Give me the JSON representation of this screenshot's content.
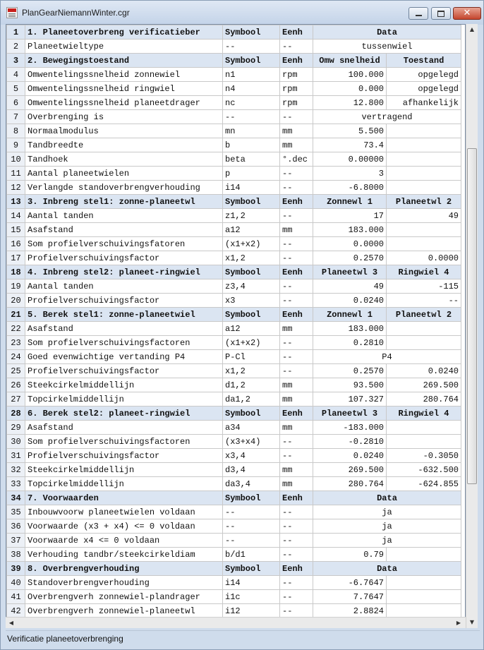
{
  "window": {
    "title": "PlanGearNiemannWinter.cgr"
  },
  "titlebar_buttons": {
    "close_glyph": "✕"
  },
  "status": {
    "text": "Verificatie planeetoverbrenging"
  },
  "scroll": {
    "up": "▲",
    "down": "▼",
    "left": "◀",
    "right": "▶"
  },
  "rows": [
    {
      "n": "1",
      "hdr": true,
      "a": "1. Planeetoverbreng verificatieber",
      "b": "Symbool",
      "c": "Eenh",
      "d": "",
      "e": "",
      "span": "Data"
    },
    {
      "n": "2",
      "a": "Planeetwieltype",
      "b": "--",
      "c": "--",
      "d": "",
      "e": "",
      "span": "tussenwiel"
    },
    {
      "n": "3",
      "hdr": true,
      "a": "2. Bewegingstoestand",
      "b": "Symbool",
      "c": "Eenh",
      "d": "Omw snelheid",
      "e": "Toestand"
    },
    {
      "n": "4",
      "a": "Omwentelingssnelheid zonnewiel",
      "b": "n1",
      "c": "rpm",
      "d": "100.000",
      "e": "opgelegd"
    },
    {
      "n": "5",
      "a": "Omwentelingssnelheid ringwiel",
      "b": "n4",
      "c": "rpm",
      "d": "0.000",
      "e": "opgelegd"
    },
    {
      "n": "6",
      "a": "Omwentelingssnelheid planeetdrager",
      "b": "nc",
      "c": "rpm",
      "d": "12.800",
      "e": "afhankelijk"
    },
    {
      "n": "7",
      "a": "Overbrenging is",
      "b": "--",
      "c": "--",
      "d": "",
      "e": "",
      "span": "vertragend"
    },
    {
      "n": "8",
      "a": "Normaalmodulus",
      "b": "mn",
      "c": "mm",
      "d": "5.500",
      "e": ""
    },
    {
      "n": "9",
      "a": "Tandbreedte",
      "b": "b",
      "c": "mm",
      "d": "73.4",
      "e": ""
    },
    {
      "n": "10",
      "a": "Tandhoek",
      "b": "beta",
      "c": "°.dec",
      "d": "0.00000",
      "e": ""
    },
    {
      "n": "11",
      "a": "Aantal planeetwielen",
      "b": "p",
      "c": "--",
      "d": "3",
      "e": ""
    },
    {
      "n": "12",
      "a": "Verlangde standoverbrengverhouding",
      "b": "i14",
      "c": "--",
      "d": "-6.8000",
      "e": ""
    },
    {
      "n": "13",
      "hdr": true,
      "a": "3. Inbreng stel1: zonne-planeetwl",
      "b": "Symbool",
      "c": "Eenh",
      "d": "Zonnewl 1",
      "e": "Planeetwl 2"
    },
    {
      "n": "14",
      "a": "Aantal tanden",
      "b": "z1,2",
      "c": "--",
      "d": "17",
      "e": "49"
    },
    {
      "n": "15",
      "a": "Asafstand",
      "b": "a12",
      "c": "mm",
      "d": "183.000",
      "e": ""
    },
    {
      "n": "16",
      "a": "Som profielverschuivingsfatoren",
      "b": "(x1+x2)",
      "c": "--",
      "d": "0.0000",
      "e": ""
    },
    {
      "n": "17",
      "a": "Profielverschuivingsfactor",
      "b": "x1,2",
      "c": "--",
      "d": "0.2570",
      "e": "0.0000"
    },
    {
      "n": "18",
      "hdr": true,
      "a": "4. Inbreng stel2: planeet-ringwiel",
      "b": "Symbool",
      "c": "Eenh",
      "d": "Planeetwl 3",
      "e": "Ringwiel 4"
    },
    {
      "n": "19",
      "a": "Aantal tanden",
      "b": "z3,4",
      "c": "--",
      "d": "49",
      "e": "-115"
    },
    {
      "n": "20",
      "a": "Profielverschuivingsfactor",
      "b": "x3",
      "c": "--",
      "d": "0.0240",
      "e": "--"
    },
    {
      "n": "21",
      "hdr": true,
      "a": "5. Berek stel1: zonne-planeetwiel",
      "b": "Symbool",
      "c": "Eenh",
      "d": "Zonnewl 1",
      "e": "Planeetwl 2"
    },
    {
      "n": "22",
      "a": "Asafstand",
      "b": "a12",
      "c": "mm",
      "d": "183.000",
      "e": ""
    },
    {
      "n": "23",
      "a": "Som profielverschuivingsfactoren",
      "b": "(x1+x2)",
      "c": "--",
      "d": "0.2810",
      "e": ""
    },
    {
      "n": "24",
      "a": "Goed evenwichtige vertanding    P4",
      "b": "P-Cl",
      "c": "--",
      "d": "",
      "e": "",
      "span": "P4"
    },
    {
      "n": "25",
      "a": "Profielverschuivingsfactor",
      "b": "x1,2",
      "c": "--",
      "d": "0.2570",
      "e": "0.0240"
    },
    {
      "n": "26",
      "a": "Steekcirkelmiddellijn",
      "b": "d1,2",
      "c": "mm",
      "d": "93.500",
      "e": "269.500"
    },
    {
      "n": "27",
      "a": "Topcirkelmiddellijn",
      "b": "da1,2",
      "c": "mm",
      "d": "107.327",
      "e": "280.764"
    },
    {
      "n": "28",
      "hdr": true,
      "a": "6. Berek stel2: planeet-ringwiel",
      "b": "Symbool",
      "c": "Eenh",
      "d": "Planeetwl 3",
      "e": "Ringwiel 4"
    },
    {
      "n": "29",
      "a": "Asafstand",
      "b": "a34",
      "c": "mm",
      "d": "-183.000",
      "e": ""
    },
    {
      "n": "30",
      "a": "Som profielverschuivingsfactoren",
      "b": "(x3+x4)",
      "c": "--",
      "d": "-0.2810",
      "e": ""
    },
    {
      "n": "31",
      "a": "Profielverschuivingsfactor",
      "b": "x3,4",
      "c": "--",
      "d": "0.0240",
      "e": "-0.3050"
    },
    {
      "n": "32",
      "a": "Steekcirkelmiddellijn",
      "b": "d3,4",
      "c": "mm",
      "d": "269.500",
      "e": "-632.500"
    },
    {
      "n": "33",
      "a": "Topcirkelmiddellijn",
      "b": "da3,4",
      "c": "mm",
      "d": "280.764",
      "e": "-624.855"
    },
    {
      "n": "34",
      "hdr": true,
      "a": "7. Voorwaarden",
      "b": "Symbool",
      "c": "Eenh",
      "d": "",
      "e": "",
      "span": "Data"
    },
    {
      "n": "35",
      "a": "Inbouwvoorw planeetwielen voldaan",
      "b": "--",
      "c": "--",
      "d": "",
      "e": "",
      "span": "ja"
    },
    {
      "n": "36",
      "a": "Voorwaarde (x3 + x4) <= 0 voldaan",
      "b": "--",
      "c": "--",
      "d": "",
      "e": "",
      "span": "ja"
    },
    {
      "n": "37",
      "a": "Voorwaarde x4 <= 0 voldaan",
      "b": "--",
      "c": "--",
      "d": "",
      "e": "",
      "span": "ja"
    },
    {
      "n": "38",
      "a": "Verhouding tandbr/steekcirkeldiam",
      "b": "b/d1",
      "c": "--",
      "d": "0.79",
      "e": ""
    },
    {
      "n": "39",
      "hdr": true,
      "a": "8. Overbrengverhouding",
      "b": "Symbool",
      "c": "Eenh",
      "d": "",
      "e": "",
      "span": "Data"
    },
    {
      "n": "40",
      "a": "Standoverbrengverhouding",
      "b": "i14",
      "c": "--",
      "d": "-6.7647",
      "e": ""
    },
    {
      "n": "41",
      "a": "Overbrengverh zonnewiel-plandrager",
      "b": "i1c",
      "c": "--",
      "d": "7.7647",
      "e": ""
    },
    {
      "n": "42",
      "a": "Overbrengverh zonnewiel-planeetwl",
      "b": "i12",
      "c": "--",
      "d": "2.8824",
      "e": ""
    }
  ]
}
